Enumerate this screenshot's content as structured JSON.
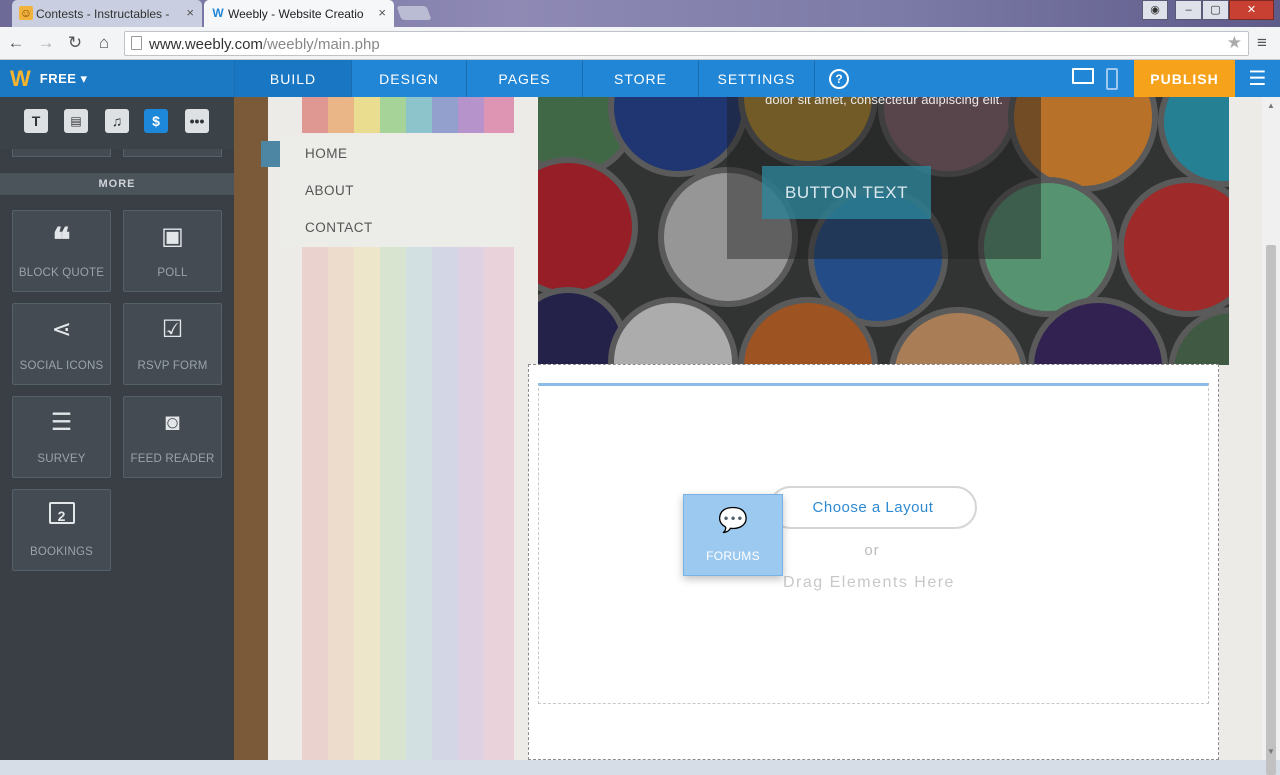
{
  "browser": {
    "tabs": [
      {
        "title": "Contests - Instructables -",
        "close": "×"
      },
      {
        "title": "Weebly - Website Creatio",
        "close": "×"
      }
    ],
    "url": {
      "domain": "www.weebly.com",
      "path": "/weebly/main.php"
    }
  },
  "weebly_nav": {
    "logo": "W",
    "plan": "FREE ▾",
    "tabs": [
      "BUILD",
      "DESIGN",
      "PAGES",
      "STORE",
      "SETTINGS"
    ],
    "help": "?",
    "publish": "PUBLISH"
  },
  "sidebar": {
    "tool_icons": [
      "text-icon",
      "layout-icon",
      "music-icon",
      "dollar-icon",
      "more-icon"
    ],
    "more_header": "MORE",
    "elements": [
      {
        "label": "BLOCK QUOTE",
        "icon": "quote-icon"
      },
      {
        "label": "POLL",
        "icon": "poll-icon"
      },
      {
        "label": "SOCIAL ICONS",
        "icon": "share-icon"
      },
      {
        "label": "RSVP FORM",
        "icon": "calendar-check-icon"
      },
      {
        "label": "SURVEY",
        "icon": "survey-icon"
      },
      {
        "label": "FEED READER",
        "icon": "rss-icon"
      },
      {
        "label": "BOOKINGS",
        "icon": "calendar-2-icon"
      }
    ]
  },
  "site": {
    "nav": [
      "HOME",
      "ABOUT",
      "CONTACT"
    ],
    "hero_text": "dolor sit amet, consectetur adipiscing elit.",
    "hero_button": "BUTTON TEXT",
    "choose_layout": "Choose a Layout",
    "or": "or",
    "drag_text": "Drag Elements Here"
  },
  "dragging_element": {
    "label": "FORUMS",
    "icon": "forums-icon"
  }
}
